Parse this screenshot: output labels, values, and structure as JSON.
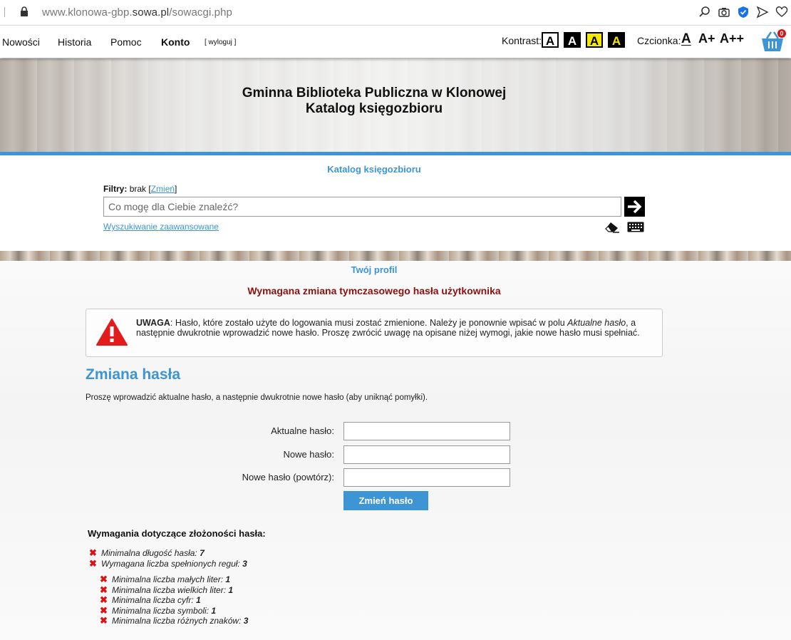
{
  "browser": {
    "url_host": "www.klonowa-gbp.",
    "url_domain": "sowa.pl",
    "url_path": "/sowacgi.php"
  },
  "nav": {
    "items": [
      {
        "label": "Nowości"
      },
      {
        "label": "Historia"
      },
      {
        "label": "Pomoc"
      },
      {
        "label": "Konto"
      }
    ],
    "logout": "[ wyloguj ]",
    "contrast_label": "Kontrast:",
    "contrast_buttons": [
      "A",
      "A",
      "A",
      "A"
    ],
    "font_label": "Czcionka:",
    "font_buttons": [
      "A",
      "A+",
      "A++"
    ],
    "cart_count": "0"
  },
  "hero": {
    "line1": "Gminna Biblioteka Publiczna w Klonowej",
    "line2": "Katalog księgozbioru"
  },
  "search": {
    "catalog_title": "Katalog księgozbioru",
    "filters_label": "Filtry:",
    "filters_value": "brak",
    "filters_change": "Zmień",
    "placeholder": "Co mogę dla Ciebie znaleźć?",
    "advanced_link": "Wyszukiwanie zaawansowane"
  },
  "main": {
    "profile_link": "Twój profil",
    "warning_title": "Wymagana zmiana tymczasowego hasła użytkownika",
    "alert": {
      "label": "UWAGA",
      "text1": ": Hasło, które zostało użyte do logowania musi zostać zmienione. Należy je ponownie wpisać w polu ",
      "text_italic": "Aktualne hasło",
      "text2": ", a następnie dwukrotnie wprowadzić nowe hasło. Proszę zwrócić uwagę na opisane niżej wymogi, jakie nowe hasło musi spełniać."
    },
    "section_title": "Zmiana hasła",
    "intro": "Proszę wprowadzić aktualne hasło, a następnie dwukrotnie nowe hasło (aby uniknąć pomyłki).",
    "form": {
      "current_label": "Aktualne hasło:",
      "new_label": "Nowe hasło:",
      "repeat_label": "Nowe hasło (powtórz):",
      "submit": "Zmień hasło"
    },
    "requirements": {
      "title": "Wymagania dotyczące złożoności hasła:",
      "main": [
        {
          "label": "Minimalna długość hasła: ",
          "value": "7"
        },
        {
          "label": "Wymagana liczba spełnionych reguł: ",
          "value": "3"
        }
      ],
      "rules": [
        {
          "label": "Minimalna liczba małych liter: ",
          "value": "1"
        },
        {
          "label": "Minimalna liczba wielkich liter: ",
          "value": "1"
        },
        {
          "label": "Minimalna liczba cyfr: ",
          "value": "1"
        },
        {
          "label": "Minimalna liczba symboli: ",
          "value": "1"
        },
        {
          "label": "Minimalna liczba różnych znaków: ",
          "value": "3"
        }
      ]
    }
  },
  "colors": {
    "accent": "#3d95d6",
    "warning_title": "#8b1010",
    "error_x": "#dd1111",
    "contrast_yellow": "#f5e800"
  }
}
